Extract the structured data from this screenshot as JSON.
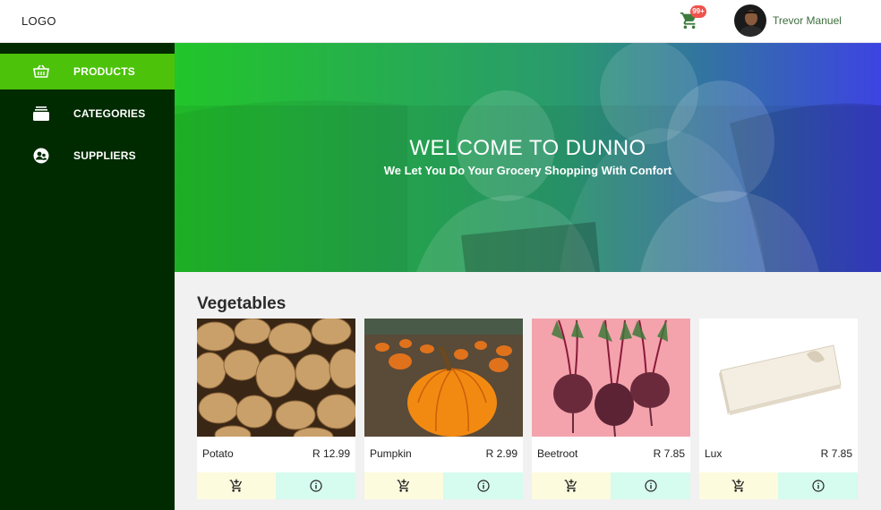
{
  "header": {
    "logo": "LOGO",
    "cart_badge": "99+",
    "user_name": "Trevor Manuel"
  },
  "sidebar": {
    "items": [
      {
        "label": "PRODUCTS",
        "icon": "basket-icon",
        "active": true
      },
      {
        "label": "CATEGORIES",
        "icon": "categories-icon",
        "active": false
      },
      {
        "label": "SUPPLIERS",
        "icon": "suppliers-icon",
        "active": false
      }
    ]
  },
  "hero": {
    "title": "WELCOME TO DUNNO",
    "subtitle": "We Let You Do Your Grocery Shopping With Confort"
  },
  "section": {
    "title": "Vegetables"
  },
  "products": [
    {
      "name": "Potato",
      "price": "R 12.99",
      "image": "potatoes"
    },
    {
      "name": "Pumpkin",
      "price": "R 2.99",
      "image": "pumpkin"
    },
    {
      "name": "Beetroot",
      "price": "R 7.85",
      "image": "beetroot"
    },
    {
      "name": "Lux",
      "price": "R 7.85",
      "image": "lux-soap"
    }
  ],
  "colors": {
    "sidebar_bg": "#002a00",
    "active_nav": "#4cc20a",
    "hero_gradient_start": "#22c52a",
    "hero_gradient_end": "#3d44e2",
    "cart_button_bg": "#fdfbde",
    "info_button_bg": "#d6fbef",
    "badge": "#f0524c"
  }
}
